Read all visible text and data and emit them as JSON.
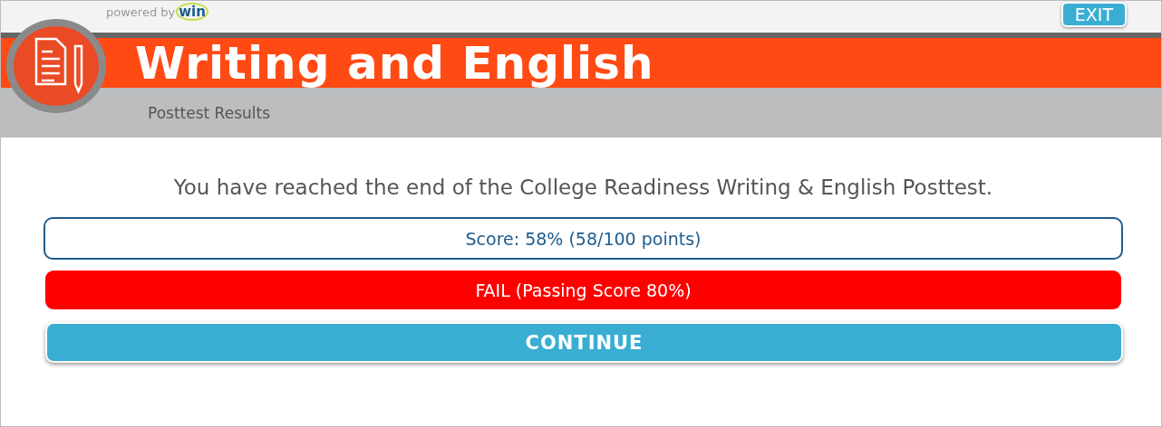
{
  "header": {
    "powered_by": "powered by",
    "brand": "win",
    "exit": "EXIT",
    "title": "Writing and English",
    "subtitle": "Posttest Results"
  },
  "message": "You have reached the end of the College Readiness Writing & English Posttest.",
  "score": "Score: 58% (58/100 points)",
  "result": {
    "kind": "fail",
    "text": "FAIL (Passing Score 80%)"
  },
  "continue": "CONTINUE"
}
